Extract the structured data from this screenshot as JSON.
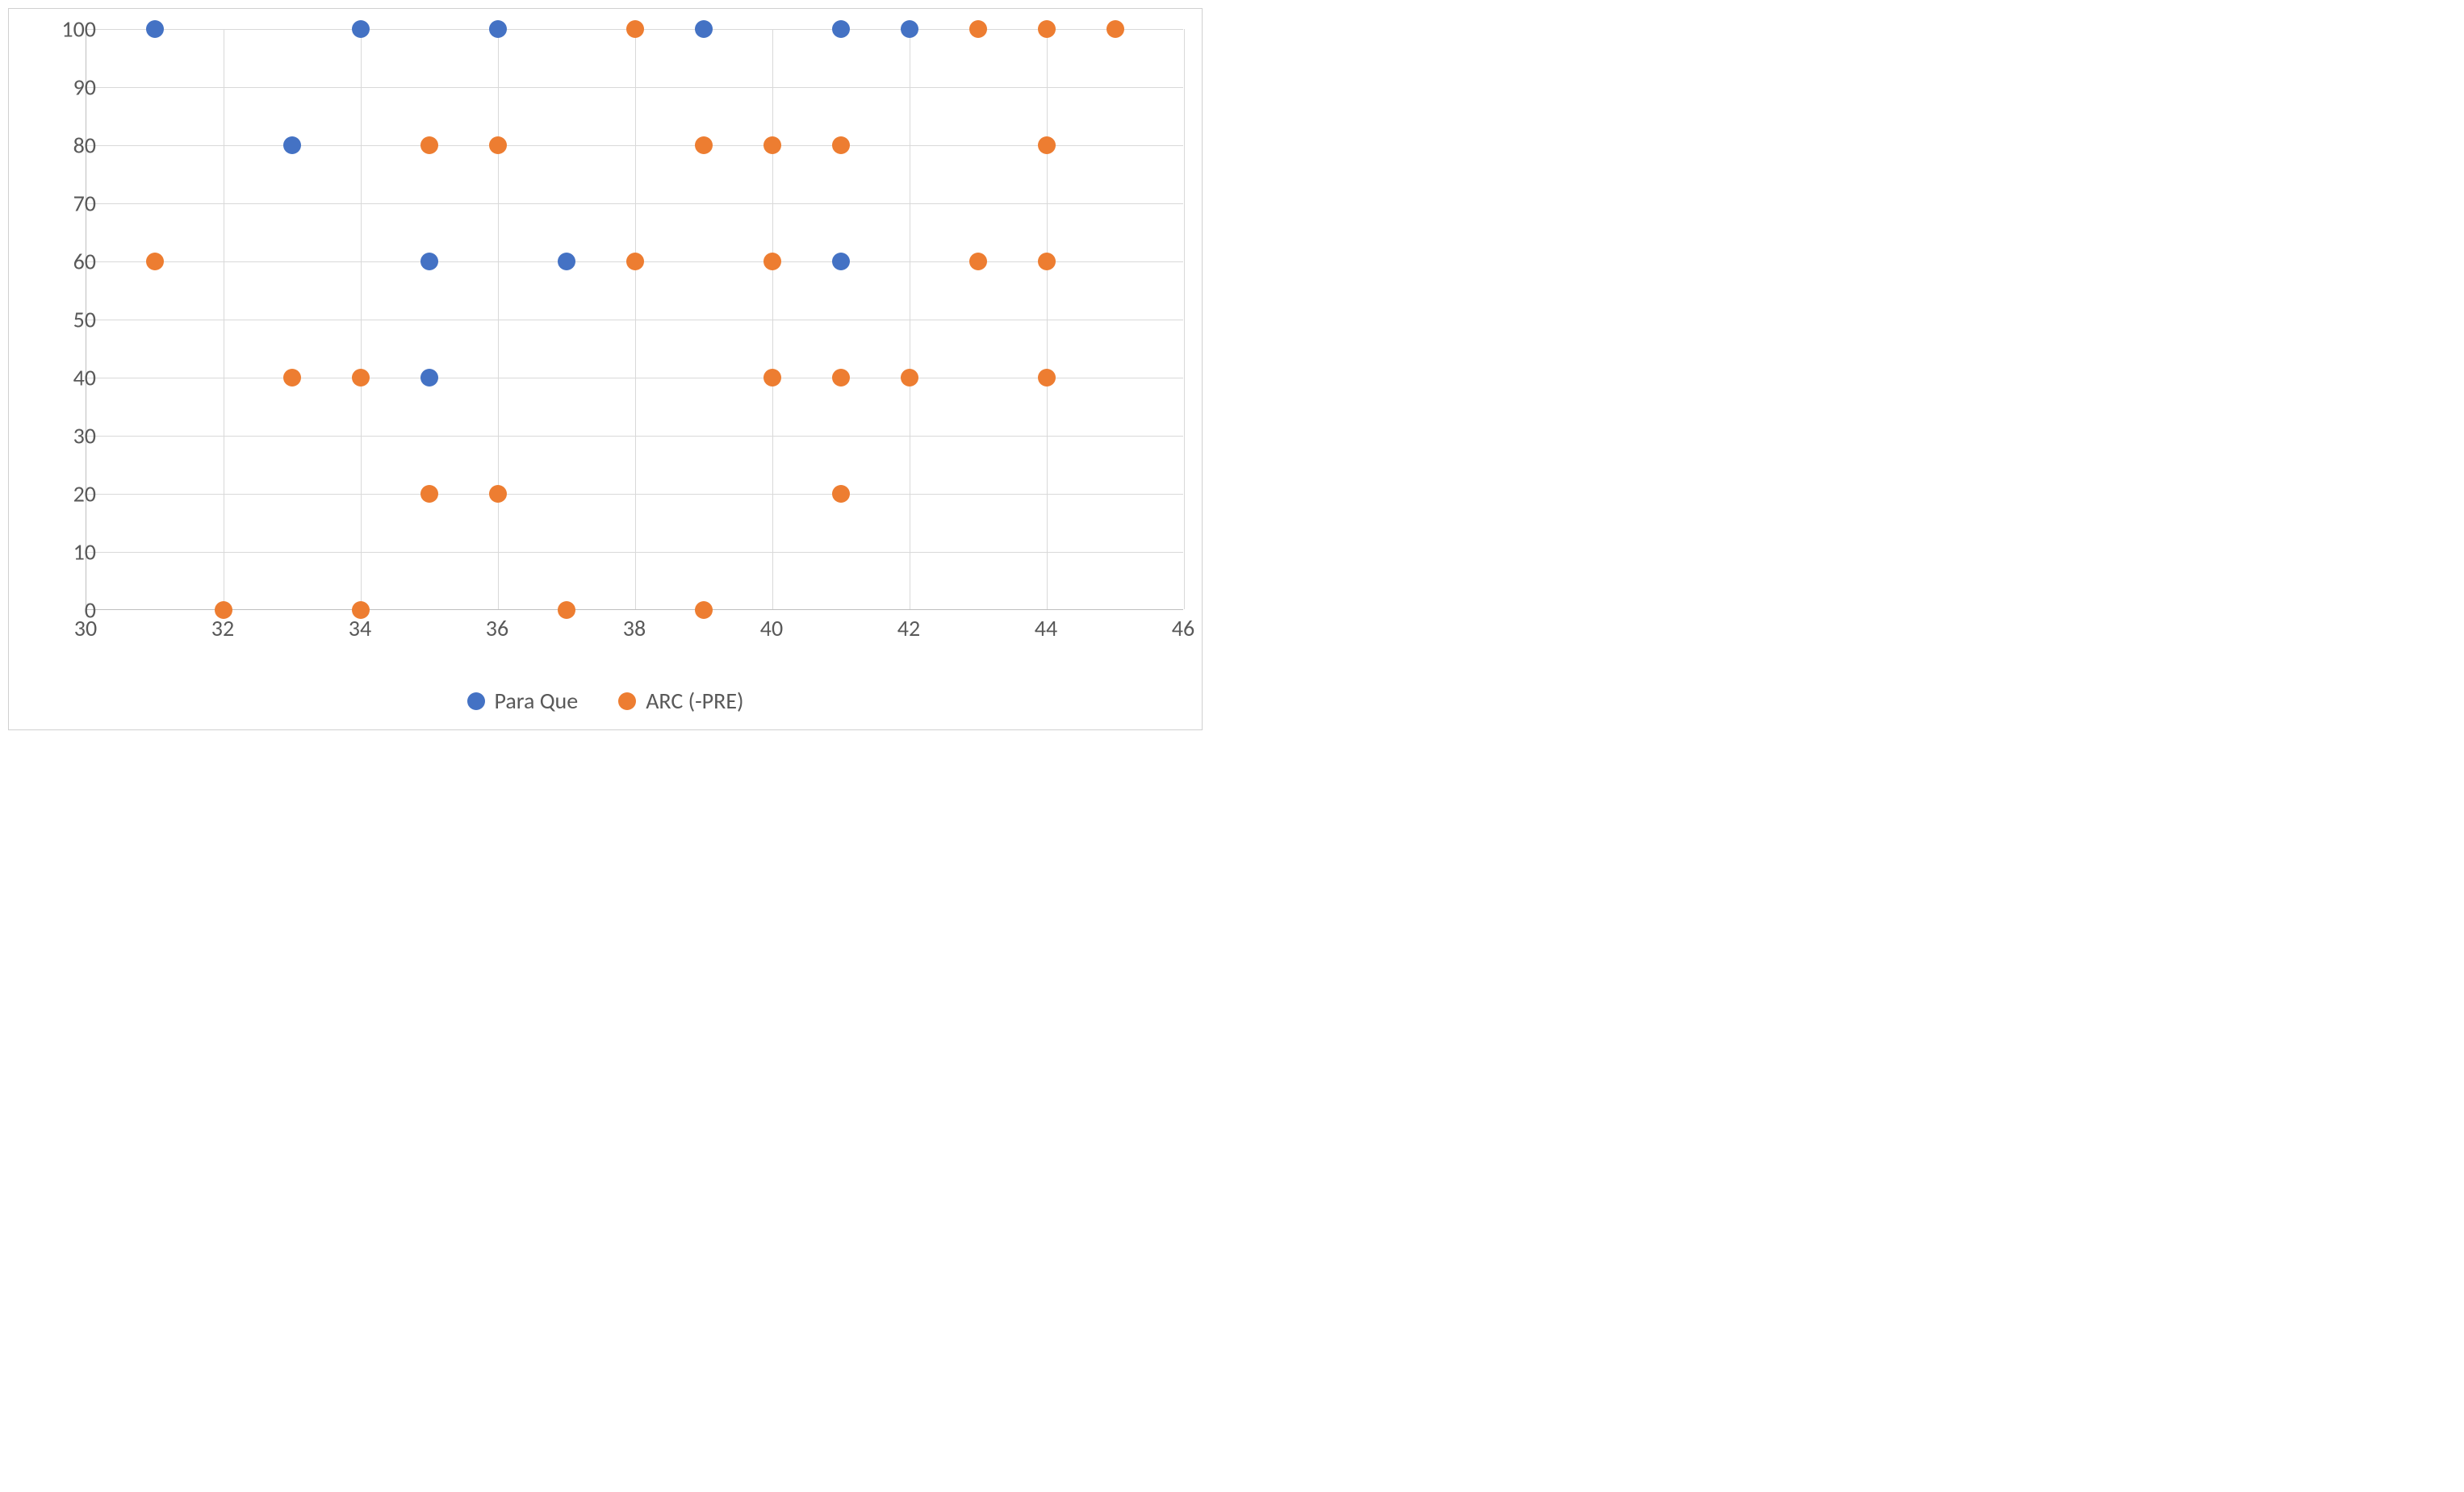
{
  "chart_data": {
    "type": "scatter",
    "x_axis": {
      "min": 30,
      "max": 46,
      "step": 2
    },
    "y_axis": {
      "min": 0,
      "max": 100,
      "step": 10
    },
    "series": [
      {
        "name": "Para Que",
        "color": "#4472c4",
        "points": [
          {
            "x": 31,
            "y": 100
          },
          {
            "x": 33,
            "y": 80
          },
          {
            "x": 34,
            "y": 100
          },
          {
            "x": 35,
            "y": 60
          },
          {
            "x": 35,
            "y": 40
          },
          {
            "x": 36,
            "y": 100
          },
          {
            "x": 37,
            "y": 60
          },
          {
            "x": 39,
            "y": 100
          },
          {
            "x": 41,
            "y": 100
          },
          {
            "x": 41,
            "y": 60
          },
          {
            "x": 42,
            "y": 100
          }
        ]
      },
      {
        "name": "ARC (-PRE)",
        "color": "#ed7d31",
        "points": [
          {
            "x": 31,
            "y": 60
          },
          {
            "x": 32,
            "y": 0
          },
          {
            "x": 33,
            "y": 40
          },
          {
            "x": 34,
            "y": 40
          },
          {
            "x": 34,
            "y": 0
          },
          {
            "x": 35,
            "y": 80
          },
          {
            "x": 35,
            "y": 20
          },
          {
            "x": 36,
            "y": 80
          },
          {
            "x": 36,
            "y": 20
          },
          {
            "x": 37,
            "y": 0
          },
          {
            "x": 38,
            "y": 100
          },
          {
            "x": 38,
            "y": 60
          },
          {
            "x": 39,
            "y": 80
          },
          {
            "x": 39,
            "y": 0
          },
          {
            "x": 40,
            "y": 80
          },
          {
            "x": 40,
            "y": 60
          },
          {
            "x": 40,
            "y": 40
          },
          {
            "x": 41,
            "y": 80
          },
          {
            "x": 41,
            "y": 40
          },
          {
            "x": 41,
            "y": 20
          },
          {
            "x": 42,
            "y": 40
          },
          {
            "x": 43,
            "y": 100
          },
          {
            "x": 43,
            "y": 60
          },
          {
            "x": 44,
            "y": 100
          },
          {
            "x": 44,
            "y": 80
          },
          {
            "x": 44,
            "y": 60
          },
          {
            "x": 44,
            "y": 40
          },
          {
            "x": 45,
            "y": 100
          }
        ]
      }
    ]
  }
}
